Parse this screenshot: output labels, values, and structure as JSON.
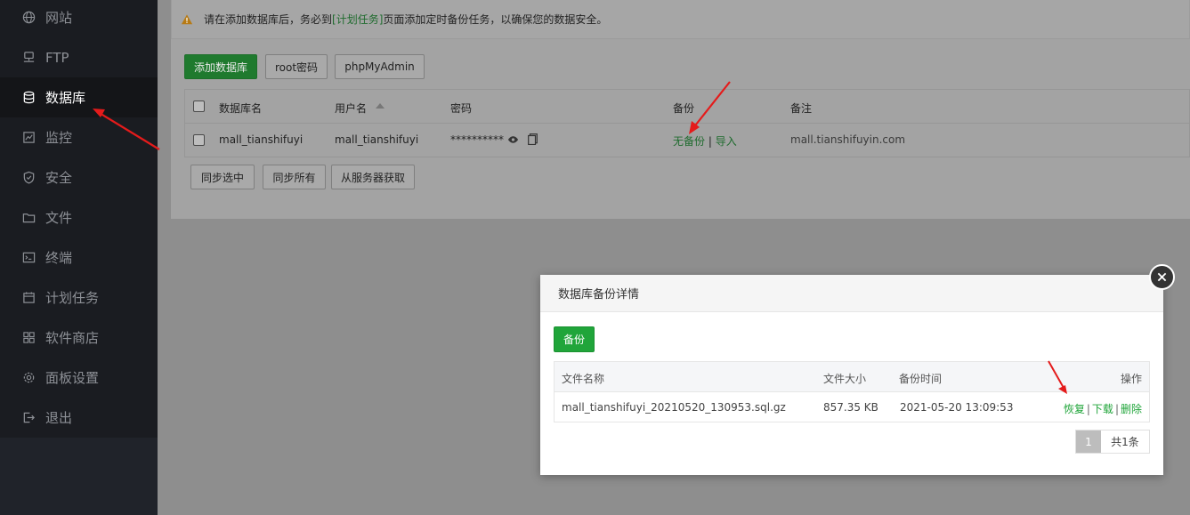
{
  "sidebar": {
    "items": [
      {
        "label": "网站",
        "icon": "globe-icon"
      },
      {
        "label": "FTP",
        "icon": "ftp-icon"
      },
      {
        "label": "数据库",
        "icon": "database-icon",
        "active": true
      },
      {
        "label": "监控",
        "icon": "monitor-icon"
      },
      {
        "label": "安全",
        "icon": "shield-icon"
      },
      {
        "label": "文件",
        "icon": "folder-icon"
      },
      {
        "label": "终端",
        "icon": "terminal-icon"
      },
      {
        "label": "计划任务",
        "icon": "calendar-icon"
      },
      {
        "label": "软件商店",
        "icon": "grid-icon"
      },
      {
        "label": "面板设置",
        "icon": "gear-icon"
      },
      {
        "label": "退出",
        "icon": "logout-icon"
      }
    ]
  },
  "notice": {
    "prefix": "请在添加数据库后，务必到",
    "link": "[计划任务]",
    "suffix": "页面添加定时备份任务，以确保您的数据安全。"
  },
  "toolbar": {
    "add_db": "添加数据库",
    "root_pwd": "root密码",
    "phpmyadmin": "phpMyAdmin"
  },
  "db_table": {
    "headers": {
      "name": "数据库名",
      "user": "用户名",
      "password": "密码",
      "backup": "备份",
      "note": "备注"
    },
    "rows": [
      {
        "name": "mall_tianshifuyi",
        "user": "mall_tianshifuyi",
        "password": "**********",
        "backup_none": "无备份",
        "backup_sep": "|",
        "import": "导入",
        "note": "mall.tianshifuyin.com"
      }
    ]
  },
  "sync": {
    "selected": "同步选中",
    "all": "同步所有",
    "from_server": "从服务器获取"
  },
  "modal": {
    "title": "数据库备份详情",
    "backup_btn": "备份",
    "headers": {
      "file": "文件名称",
      "size": "文件大小",
      "time": "备份时间",
      "ops": "操作"
    },
    "rows": [
      {
        "file": "mall_tianshifuyi_20210520_130953.sql.gz",
        "size": "857.35 KB",
        "time": "2021-05-20 13:09:53",
        "restore": "恢复",
        "download": "下载",
        "delete": "删除",
        "sep": "|"
      }
    ],
    "pager": {
      "current": "1",
      "total": "共1条"
    }
  },
  "colors": {
    "accent_green": "#20a53a",
    "sidebar_bg": "#20232a",
    "arrow_red": "#e41b1b"
  }
}
